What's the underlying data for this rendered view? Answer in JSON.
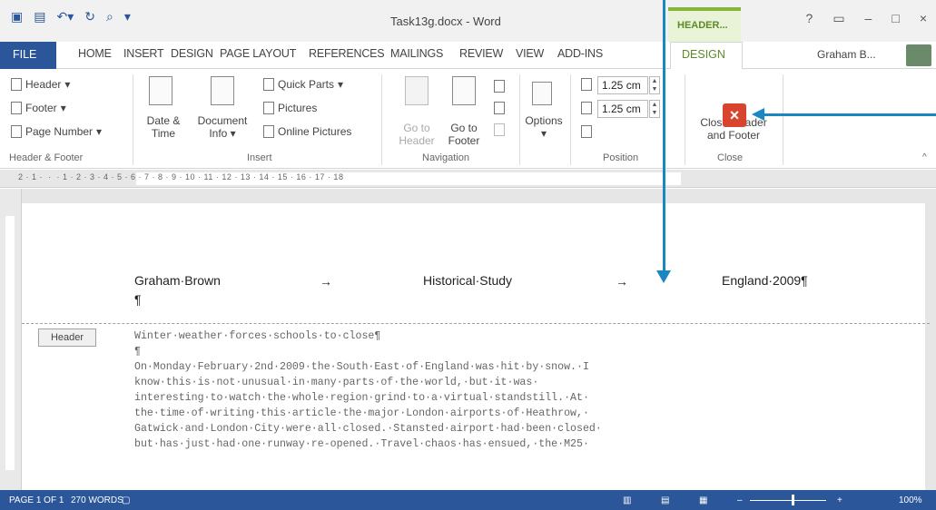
{
  "window": {
    "title": "Task13g.docx - Word",
    "context_tab_group": "HEADER...",
    "user_name": "Graham B...",
    "controls": [
      "?",
      "▭",
      "–",
      "□",
      "×"
    ]
  },
  "tabs": [
    "FILE",
    "HOME",
    "INSERT",
    "DESIGN",
    "PAGE LAYOUT",
    "REFERENCES",
    "MAILINGS",
    "REVIEW",
    "VIEW",
    "ADD-INS"
  ],
  "active_context_tab": "DESIGN",
  "ribbon": {
    "header_footer": {
      "header": "Header",
      "footer": "Footer",
      "page_number": "Page Number",
      "label": "Header & Footer"
    },
    "insert": {
      "date_time_1": "Date &",
      "date_time_2": "Time",
      "doc_info_1": "Document",
      "doc_info_2": "Info",
      "quick_parts": "Quick Parts",
      "pictures": "Pictures",
      "online_pictures": "Online Pictures",
      "label": "Insert"
    },
    "navigation": {
      "goto_header_1": "Go to",
      "goto_header_2": "Header",
      "goto_footer_1": "Go to",
      "goto_footer_2": "Footer",
      "label": "Navigation"
    },
    "options": {
      "label_button": "Options"
    },
    "position": {
      "header_from_top": "1.25 cm",
      "footer_from_bottom": "1.25 cm",
      "label": "Position"
    },
    "close": {
      "button_1": "Close Header",
      "button_2": "and Footer",
      "label": "Close"
    }
  },
  "ruler": {
    "numbers": "2 · 1 ·  ·  · 1 · 2 · 3 · 4 · 5 · 6 · 7 · 8 · 9 · 10 · 11 · 12 · 13 · 14 · 15 · 16 · 17 · 18"
  },
  "document": {
    "header_left": "Graham·Brown",
    "header_center": "Historical·Study",
    "header_right": "England·2009¶",
    "header_para_mark": "¶",
    "header_tag": "Header",
    "tab_arrow": "→",
    "lines": [
      "Winter·weather·forces·schools·to·close¶",
      "¶",
      "On·Monday·February·2nd·2009·the·South·East·of·England·was·hit·by·snow.·I",
      "know·this·is·not·unusual·in·many·parts·of·the·world,·but·it·was·",
      "interesting·to·watch·the·whole·region·grind·to·a·virtual·standstill.·At·",
      "the·time·of·writing·this·article·the·major·London·airports·of·Heathrow,·",
      "Gatwick·and·London·City·were·all·closed.·Stansted·airport·had·been·closed·",
      "but·has·just·had·one·runway·re-opened.·Travel·chaos·has·ensued,·the·M25·"
    ]
  },
  "status": {
    "page": "PAGE 1 OF 1",
    "words": "270 WORDS",
    "zoom": "100%",
    "zoom_minus": "–",
    "zoom_plus": "+"
  }
}
